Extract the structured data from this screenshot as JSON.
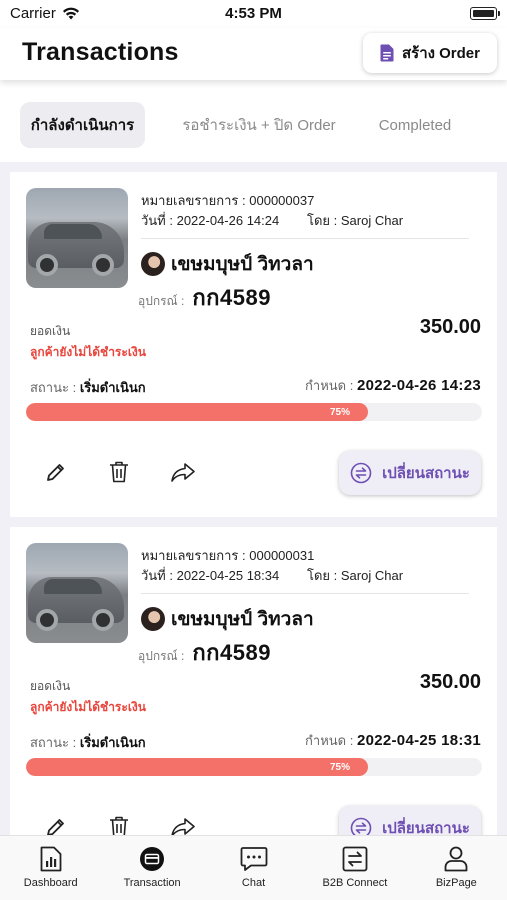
{
  "status_bar": {
    "carrier": "Carrier",
    "time": "4:53 PM"
  },
  "header": {
    "title": "Transactions",
    "create_button_label": "สร้าง Order"
  },
  "tabs": [
    {
      "label": "กำลังดำเนินการ",
      "active": true
    },
    {
      "label": "รอชำระเงิน + ปิด Order",
      "active": false
    },
    {
      "label": "Completed",
      "active": false
    }
  ],
  "transactions": [
    {
      "id_label": "หมายเลขรายการ : ",
      "id": "000000037",
      "date_label": "วันที่ : ",
      "date": "2022-04-26 14:24",
      "by_label": "โดย : ",
      "by": "Saroj Char",
      "customer": "เขษมบุษป์ วิทวลา",
      "device_label": "อุปกรณ์ :",
      "device": "กก4589",
      "amount_label": "ยอดเงิน",
      "amount": "350.00",
      "payment_status": "ลูกค้ายังไม่ได้ชำระเงิน",
      "state_label": "สถานะ : ",
      "state": "เริ่มดำเนินก",
      "due_label": "กำหนด : ",
      "due": "2022-04-26 14:23",
      "progress": 75,
      "progress_label": "75%",
      "change_status_label": "เปลี่ยนสถานะ"
    },
    {
      "id_label": "หมายเลขรายการ : ",
      "id": "000000031",
      "date_label": "วันที่ : ",
      "date": "2022-04-25 18:34",
      "by_label": "โดย : ",
      "by": "Saroj Char",
      "customer": "เขษมบุษป์ วิทวลา",
      "device_label": "อุปกรณ์ :",
      "device": "กก4589",
      "amount_label": "ยอดเงิน",
      "amount": "350.00",
      "payment_status": "ลูกค้ายังไม่ได้ชำระเงิน",
      "state_label": "สถานะ : ",
      "state": "เริ่มดำเนินก",
      "due_label": "กำหนด : ",
      "due": "2022-04-25 18:31",
      "progress": 75,
      "progress_label": "75%",
      "change_status_label": "เปลี่ยนสถานะ"
    }
  ],
  "tabbar": [
    {
      "label": "Dashboard",
      "icon": "dashboard-icon"
    },
    {
      "label": "Transaction",
      "icon": "transaction-icon"
    },
    {
      "label": "Chat",
      "icon": "chat-icon"
    },
    {
      "label": "B2B Connect",
      "icon": "b2b-connect-icon"
    },
    {
      "label": "BizPage",
      "icon": "bizpage-icon"
    }
  ],
  "colors": {
    "accent": "#6e4fb3",
    "progress": "#f37169",
    "warning": "#e8453c",
    "background": "#f1f0f6"
  }
}
